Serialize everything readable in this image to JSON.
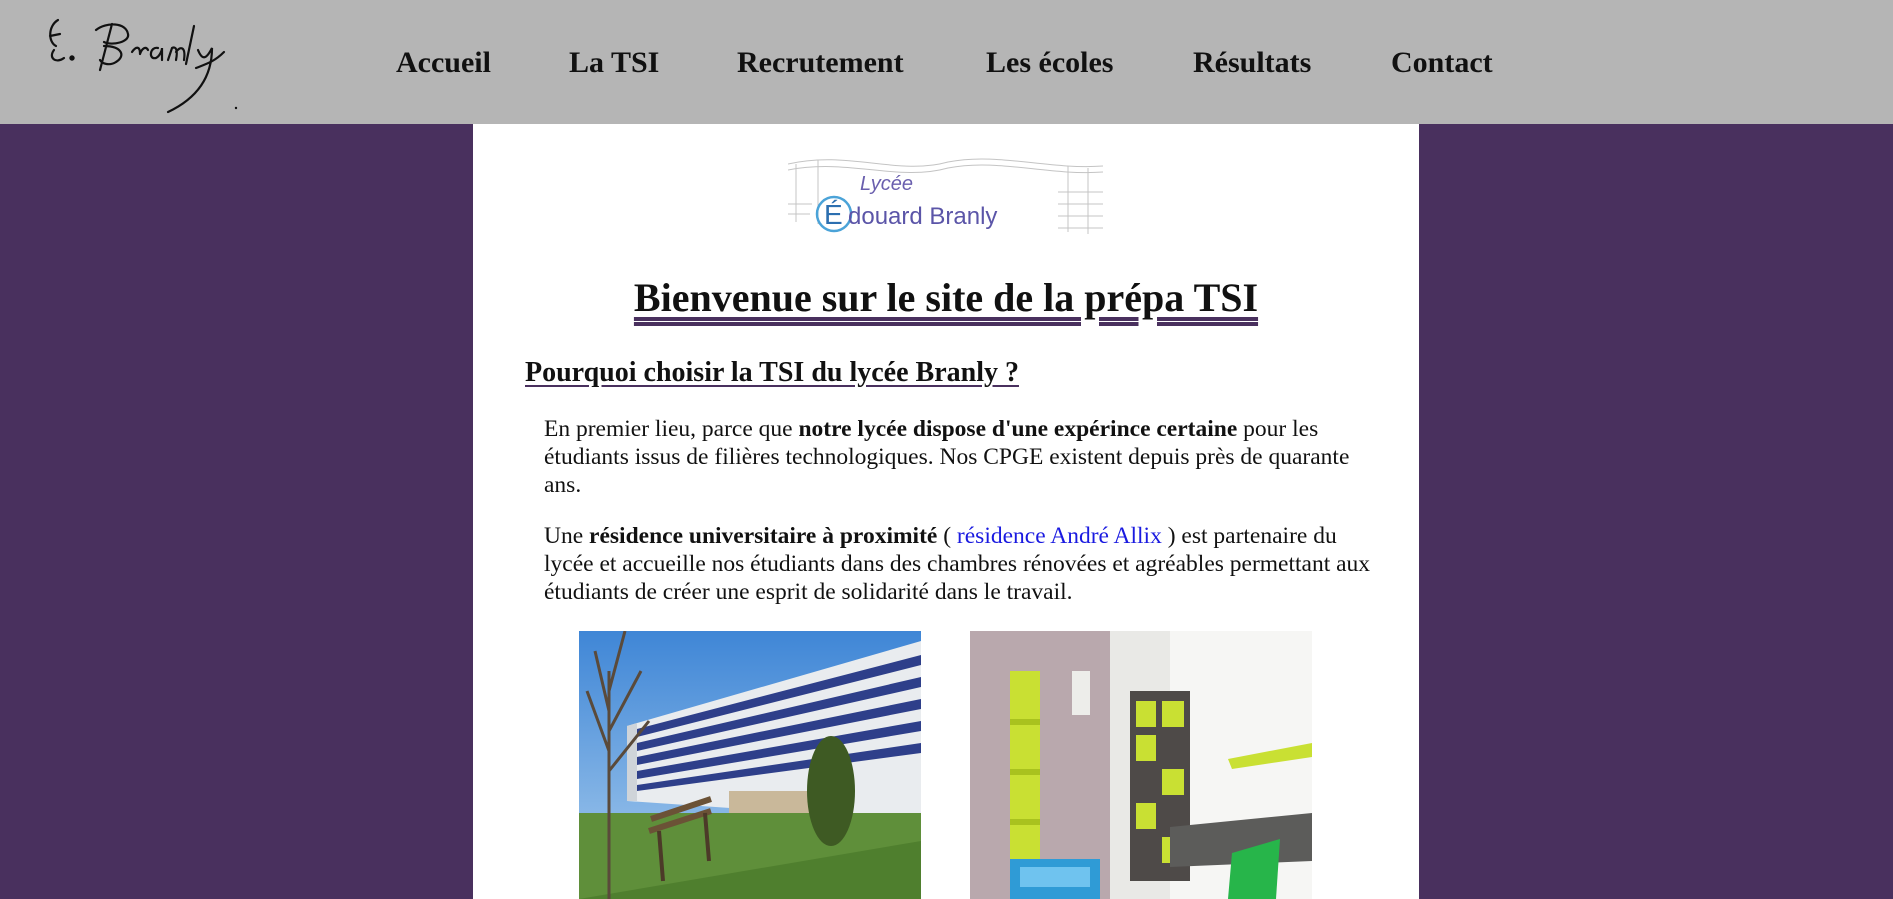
{
  "nav": {
    "items": [
      {
        "label": "Accueil"
      },
      {
        "label": "La TSI"
      },
      {
        "label": "Recrutement"
      },
      {
        "label": "Les écoles"
      },
      {
        "label": "Résultats"
      },
      {
        "label": "Contact"
      }
    ]
  },
  "logo": {
    "line1": "Lycée",
    "line2": "douard Branly",
    "letter": "É"
  },
  "main": {
    "title": "Bienvenue sur le site de la prépa TSI",
    "section_title": "Pourquoi choisir la TSI du lycée Branly ?",
    "p1": {
      "pre": "En premier lieu, parce que ",
      "bold": "notre lycée dispose d'une expérince certaine",
      "post": " pour les étudiants issus de filières technologiques. Nos CPGE existent depuis près de quarante ans."
    },
    "p2": {
      "pre": "Une ",
      "bold": "résidence universitaire à proximité",
      "mid": " ( ",
      "link": "résidence André Allix",
      "post": " ) est partenaire du lycée et accueille nos étudiants dans des chambres rénovées et agréables permettant aux étudiants de créer une esprit de solidarité dans le travail."
    }
  },
  "colors": {
    "header_bg": "#b5b5b5",
    "page_bg": "#49305e",
    "panel_bg": "#ffffff",
    "link": "#1a1ae0"
  }
}
